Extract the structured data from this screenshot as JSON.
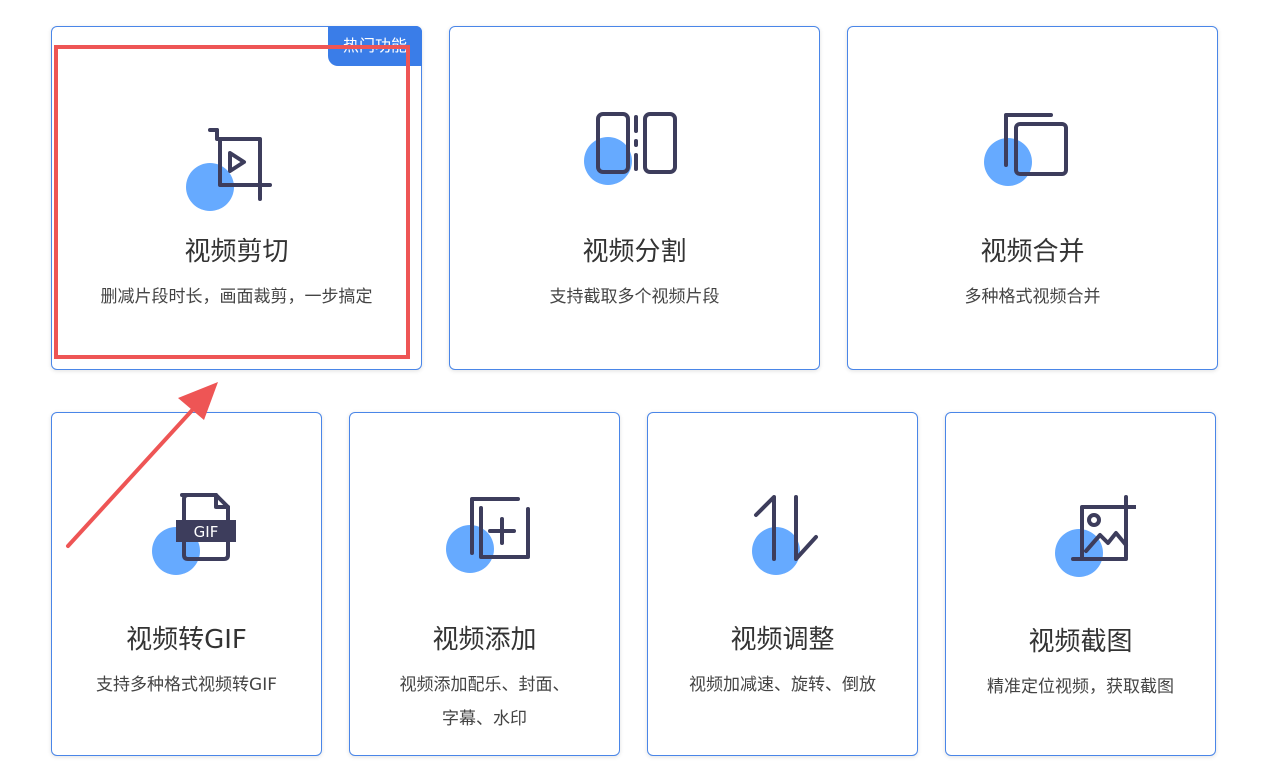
{
  "badge": {
    "label": "热门功能"
  },
  "cards": [
    {
      "title": "视频剪切",
      "desc": "删减片段时长，画面裁剪，一步搞定",
      "icon": "crop-video-icon"
    },
    {
      "title": "视频分割",
      "desc": "支持截取多个视频片段",
      "icon": "split-video-icon"
    },
    {
      "title": "视频合并",
      "desc": "多种格式视频合并",
      "icon": "merge-video-icon"
    },
    {
      "title": "视频转GIF",
      "desc": "支持多种格式视频转GIF",
      "icon": "gif-file-icon"
    },
    {
      "title": "视频添加",
      "desc": "视频添加配乐、封面、",
      "desc2": "字幕、水印",
      "icon": "add-box-icon"
    },
    {
      "title": "视频调整",
      "desc": "视频加减速、旋转、倒放",
      "icon": "adjust-arrows-icon"
    },
    {
      "title": "视频截图",
      "desc": "精准定位视频，获取截图",
      "icon": "image-crop-icon"
    }
  ],
  "colors": {
    "accent": "#3a7de8",
    "circle": "#66aaff",
    "stroke": "#3d3d5c",
    "highlight": "#ee5555"
  }
}
